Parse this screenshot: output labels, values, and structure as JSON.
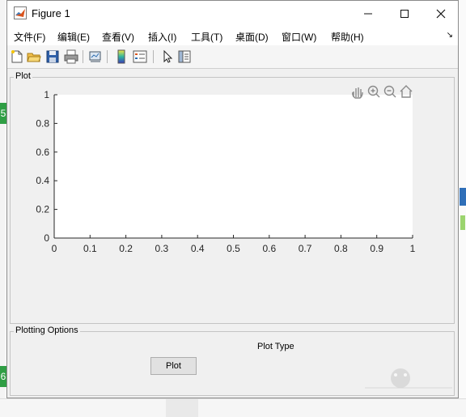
{
  "window": {
    "title": "Figure 1",
    "controls": {
      "minimize": "—",
      "maximize": "☐",
      "close": "✕"
    }
  },
  "menu": {
    "items": [
      "文件(F)",
      "编辑(E)",
      "查看(V)",
      "插入(I)",
      "工具(T)",
      "桌面(D)",
      "窗口(W)",
      "帮助(H)"
    ],
    "overflow_arrow": "↘"
  },
  "toolbar": {
    "icons": [
      "new-figure-icon",
      "open-file-icon",
      "save-icon",
      "print-icon",
      "link-plot-icon",
      "insert-colorbar-icon",
      "insert-legend-icon",
      "pointer-icon",
      "property-inspector-icon"
    ]
  },
  "plot_panel": {
    "title": "Plot",
    "axes_toolbar": [
      "pan-icon",
      "zoom-in-icon",
      "zoom-out-icon",
      "restore-view-icon"
    ]
  },
  "chart_data": {
    "type": "line",
    "series": [],
    "xlim": [
      0,
      1
    ],
    "ylim": [
      0,
      1
    ],
    "x_ticks": [
      "0",
      "0.1",
      "0.2",
      "0.3",
      "0.4",
      "0.5",
      "0.6",
      "0.7",
      "0.8",
      "0.9",
      "1"
    ],
    "y_ticks": [
      "0",
      "0.2",
      "0.4",
      "0.6",
      "0.8",
      "1"
    ],
    "grid": false
  },
  "options_panel": {
    "title": "Plotting Options",
    "plot_type_label": "Plot Type",
    "plot_button_label": "Plot"
  },
  "background": {
    "left_badges": [
      "5",
      "6"
    ]
  },
  "colors": {
    "window_bg": "#f0f0f0",
    "axes_bg": "#ffffff",
    "badge_green": "#2f9e44",
    "accent_blue": "#2f6fb8"
  }
}
